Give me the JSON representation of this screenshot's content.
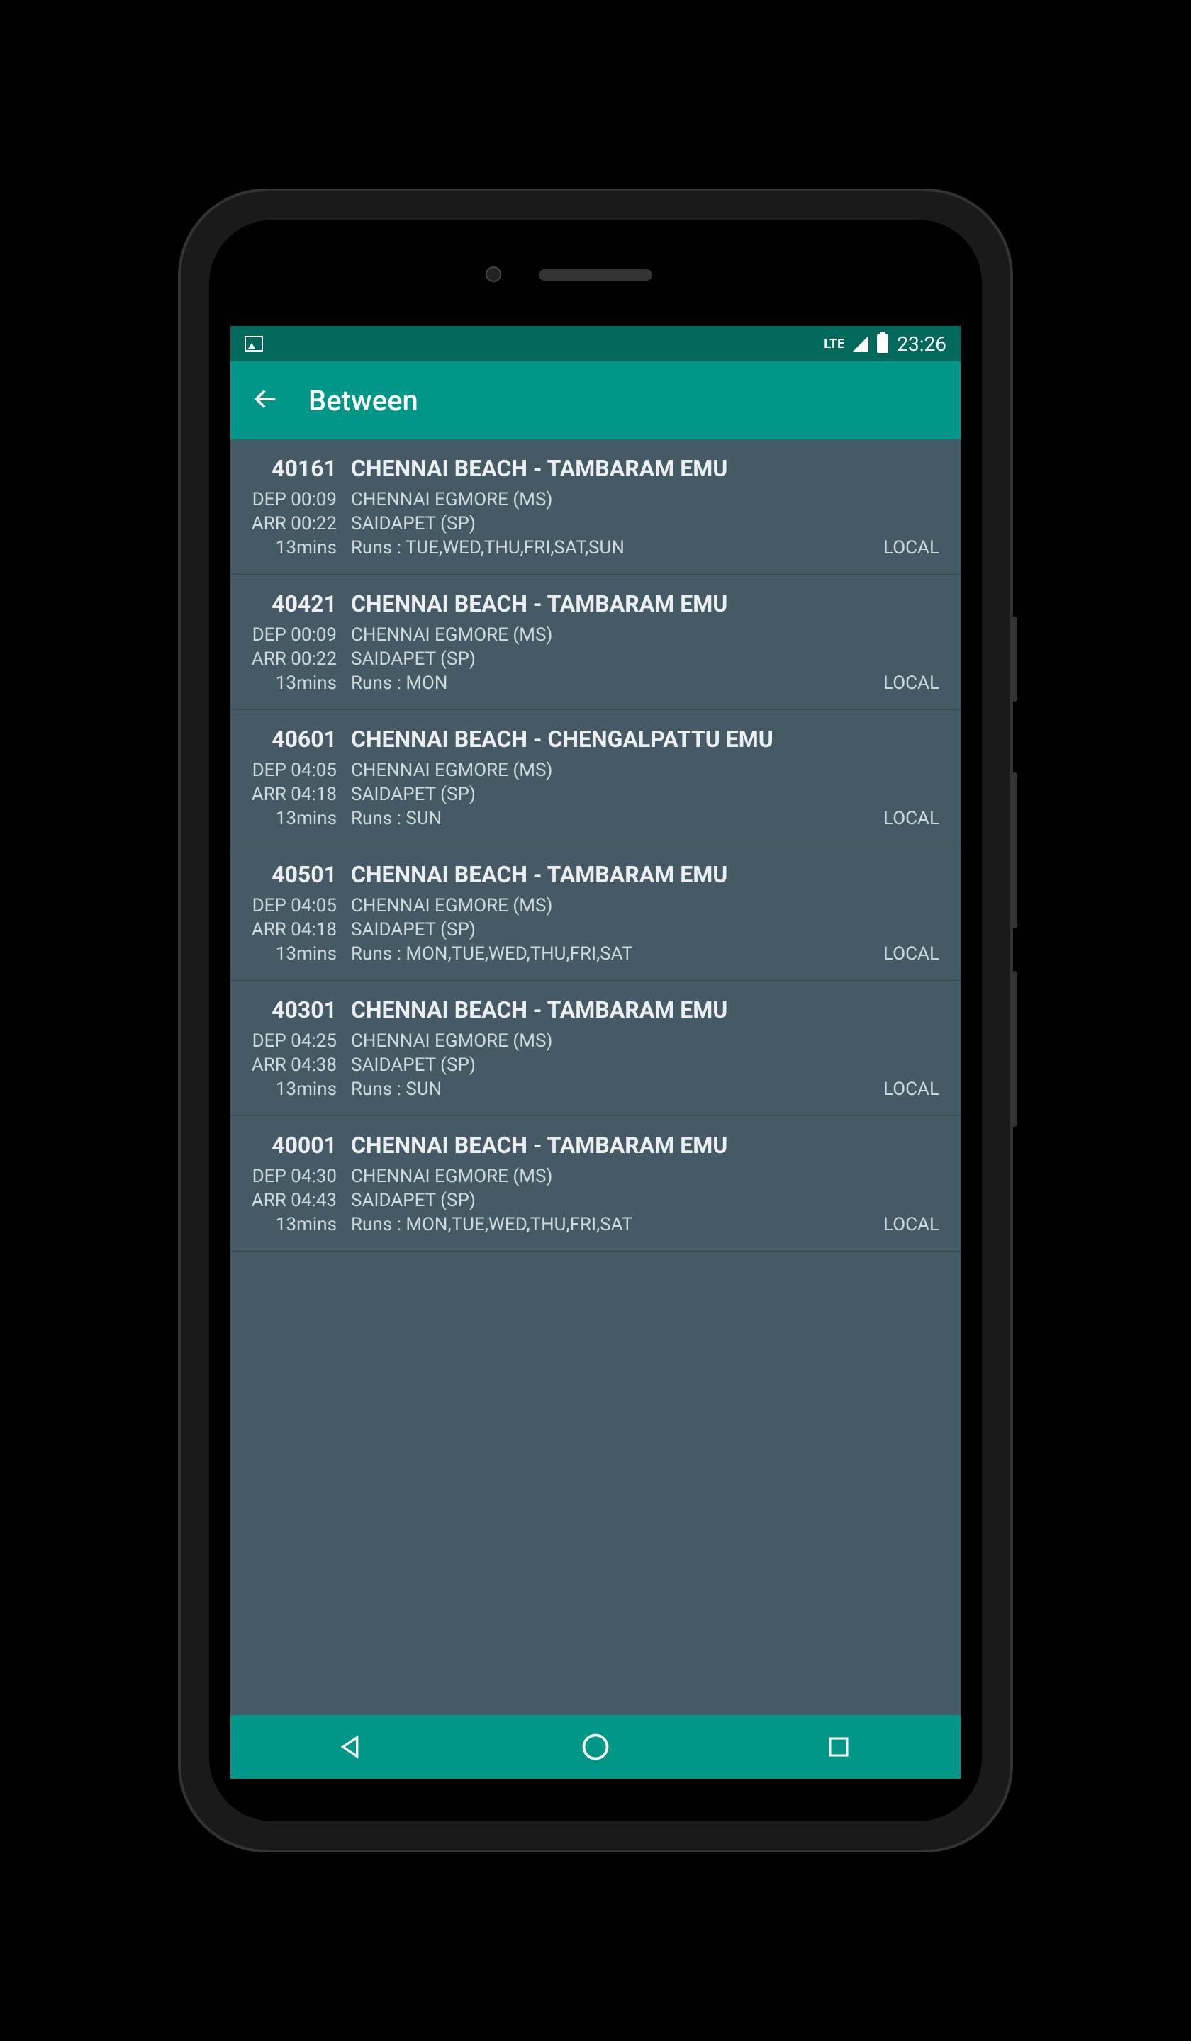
{
  "status": {
    "network": "LTE",
    "time": "23:26"
  },
  "appbar": {
    "title": "Between"
  },
  "trains": [
    {
      "no": "40161",
      "name": "CHENNAI BEACH - TAMBARAM EMU",
      "dep_label": "DEP 00:09",
      "dep_station": "CHENNAI EGMORE (MS)",
      "arr_label": "ARR 00:22",
      "arr_station": "SAIDAPET (SP)",
      "duration": "13mins",
      "runs": "Runs : TUE,WED,THU,FRI,SAT,SUN",
      "type": "LOCAL"
    },
    {
      "no": "40421",
      "name": "CHENNAI BEACH - TAMBARAM EMU",
      "dep_label": "DEP 00:09",
      "dep_station": "CHENNAI EGMORE (MS)",
      "arr_label": "ARR 00:22",
      "arr_station": "SAIDAPET (SP)",
      "duration": "13mins",
      "runs": "Runs : MON",
      "type": "LOCAL"
    },
    {
      "no": "40601",
      "name": "CHENNAI BEACH - CHENGALPATTU EMU",
      "dep_label": "DEP 04:05",
      "dep_station": "CHENNAI EGMORE (MS)",
      "arr_label": "ARR 04:18",
      "arr_station": "SAIDAPET (SP)",
      "duration": "13mins",
      "runs": "Runs : SUN",
      "type": "LOCAL"
    },
    {
      "no": "40501",
      "name": "CHENNAI BEACH - TAMBARAM EMU",
      "dep_label": "DEP 04:05",
      "dep_station": "CHENNAI EGMORE (MS)",
      "arr_label": "ARR 04:18",
      "arr_station": "SAIDAPET (SP)",
      "duration": "13mins",
      "runs": "Runs : MON,TUE,WED,THU,FRI,SAT",
      "type": "LOCAL"
    },
    {
      "no": "40301",
      "name": "CHENNAI BEACH - TAMBARAM EMU",
      "dep_label": "DEP 04:25",
      "dep_station": "CHENNAI EGMORE (MS)",
      "arr_label": "ARR 04:38",
      "arr_station": "SAIDAPET (SP)",
      "duration": "13mins",
      "runs": "Runs : SUN",
      "type": "LOCAL"
    },
    {
      "no": "40001",
      "name": "CHENNAI BEACH - TAMBARAM EMU",
      "dep_label": "DEP 04:30",
      "dep_station": "CHENNAI EGMORE (MS)",
      "arr_label": "ARR 04:43",
      "arr_station": "SAIDAPET (SP)",
      "duration": "13mins",
      "runs": "Runs : MON,TUE,WED,THU,FRI,SAT",
      "type": "LOCAL"
    }
  ]
}
